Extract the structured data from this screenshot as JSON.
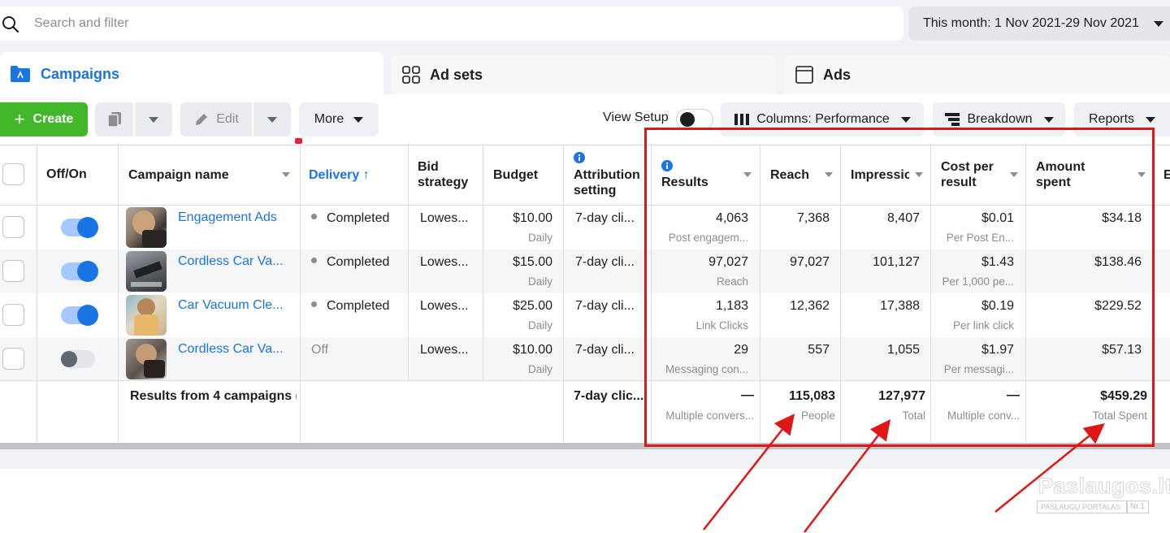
{
  "search": {
    "placeholder": "Search and filter"
  },
  "date_range": {
    "label": "This month: 1 Nov 2021-29 Nov 2021"
  },
  "tabs": [
    {
      "label": "Campaigns"
    },
    {
      "label": "Ad sets"
    },
    {
      "label": "Ads"
    }
  ],
  "toolbar": {
    "create_label": "Create",
    "edit_label": "Edit",
    "more_label": "More",
    "view_setup_label": "View Setup",
    "columns_label": "Columns: Performance",
    "breakdown_label": "Breakdown",
    "reports_label": "Reports"
  },
  "columns": {
    "off_on": "Off/On",
    "campaign_name": "Campaign name",
    "delivery": "Delivery ↑",
    "bid_strategy": "Bid strategy",
    "budget": "Budget",
    "attribution": "Attribution setting",
    "results": "Results",
    "reach": "Reach",
    "impressions": "Impressic",
    "cost_per_result": "Cost per result",
    "amount_spent": "Amount spent",
    "next_partial": "E"
  },
  "rows": [
    {
      "name": "Engagement Ads",
      "delivery": "Completed",
      "bid": "Lowes...",
      "budget": "$10.00",
      "budget_sub": "Daily",
      "attribution": "7-day cli...",
      "results": "4,063",
      "results_sub": "Post engagem...",
      "reach": "7,368",
      "impressions": "8,407",
      "cpr": "$0.01",
      "cpr_sub": "Per Post En...",
      "spent": "$34.18"
    },
    {
      "name": "Cordless Car Va...",
      "delivery": "Completed",
      "bid": "Lowes...",
      "budget": "$15.00",
      "budget_sub": "Daily",
      "attribution": "7-day cli...",
      "results": "97,027",
      "results_sub": "Reach",
      "reach": "97,027",
      "impressions": "101,127",
      "cpr": "$1.43",
      "cpr_sub": "Per 1,000 pe...",
      "spent": "$138.46"
    },
    {
      "name": "Car Vacuum Cle...",
      "delivery": "Completed",
      "bid": "Lowes...",
      "budget": "$25.00",
      "budget_sub": "Daily",
      "attribution": "7-day cli...",
      "results": "1,183",
      "results_sub": "Link Clicks",
      "reach": "12,362",
      "impressions": "17,388",
      "cpr": "$0.19",
      "cpr_sub": "Per link click",
      "spent": "$229.52"
    },
    {
      "name": "Cordless Car Va...",
      "delivery": "Off",
      "bid": "Lowes...",
      "budget": "$10.00",
      "budget_sub": "Daily",
      "attribution": "7-day cli...",
      "results": "29",
      "results_sub": "Messaging con...",
      "reach": "557",
      "impressions": "1,055",
      "cpr": "$1.97",
      "cpr_sub": "Per messagi...",
      "spent": "$57.13"
    }
  ],
  "row_states": [
    true,
    true,
    true,
    false
  ],
  "summary": {
    "label": "Results from 4 campaigns",
    "label_tail": "(",
    "attribution": "7-day clic...",
    "results": "—",
    "results_sub": "Multiple convers...",
    "reach": "115,083",
    "reach_sub": "People",
    "impressions": "127,977",
    "impressions_sub": "Total",
    "cpr": "—",
    "cpr_sub": "Multiple conv...",
    "spent": "$459.29",
    "spent_sub": "Total Spent"
  },
  "watermark": {
    "main": "Paslaugos.lt",
    "sub": "PASLAUGŲ PORTALAS",
    "nr": "Nr.1"
  },
  "colors": {
    "accent": "#1b74e4",
    "create": "#42b72a",
    "annotation": "#e01717"
  },
  "icons": [
    "search-icon",
    "campaigns-folder-icon",
    "adsets-grid-icon",
    "ads-window-icon",
    "duplicate-icon",
    "pencil-icon",
    "columns-icon",
    "breakdown-icon",
    "info-icon"
  ]
}
